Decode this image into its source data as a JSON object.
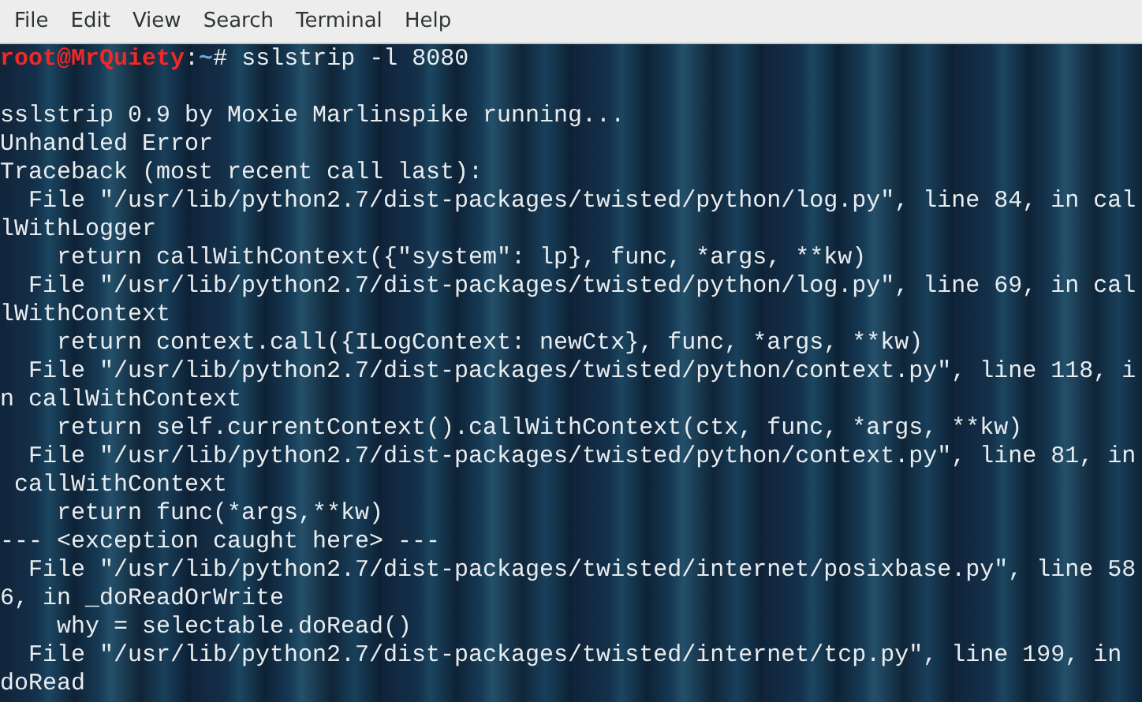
{
  "menu": [
    "File",
    "Edit",
    "View",
    "Search",
    "Terminal",
    "Help"
  ],
  "prompt": {
    "user": "root@MrQuiety",
    "separator": ":",
    "path": "~",
    "symbol": "#",
    "command": "sslstrip -l 8080"
  },
  "lines": [
    "sslstrip 0.9 by Moxie Marlinspike running...",
    "Unhandled Error",
    "Traceback (most recent call last):",
    "  File \"/usr/lib/python2.7/dist-packages/twisted/python/log.py\", line 84, in cal",
    "lWithLogger",
    "    return callWithContext({\"system\": lp}, func, *args, **kw)",
    "  File \"/usr/lib/python2.7/dist-packages/twisted/python/log.py\", line 69, in cal",
    "lWithContext",
    "    return context.call({ILogContext: newCtx}, func, *args, **kw)",
    "  File \"/usr/lib/python2.7/dist-packages/twisted/python/context.py\", line 118, i",
    "n callWithContext",
    "    return self.currentContext().callWithContext(ctx, func, *args, **kw)",
    "  File \"/usr/lib/python2.7/dist-packages/twisted/python/context.py\", line 81, in",
    " callWithContext",
    "    return func(*args,**kw)",
    "--- <exception caught here> ---",
    "  File \"/usr/lib/python2.7/dist-packages/twisted/internet/posixbase.py\", line 58",
    "6, in _doReadOrWrite",
    "    why = selectable.doRead()",
    "  File \"/usr/lib/python2.7/dist-packages/twisted/internet/tcp.py\", line 199, in",
    "doRead"
  ]
}
